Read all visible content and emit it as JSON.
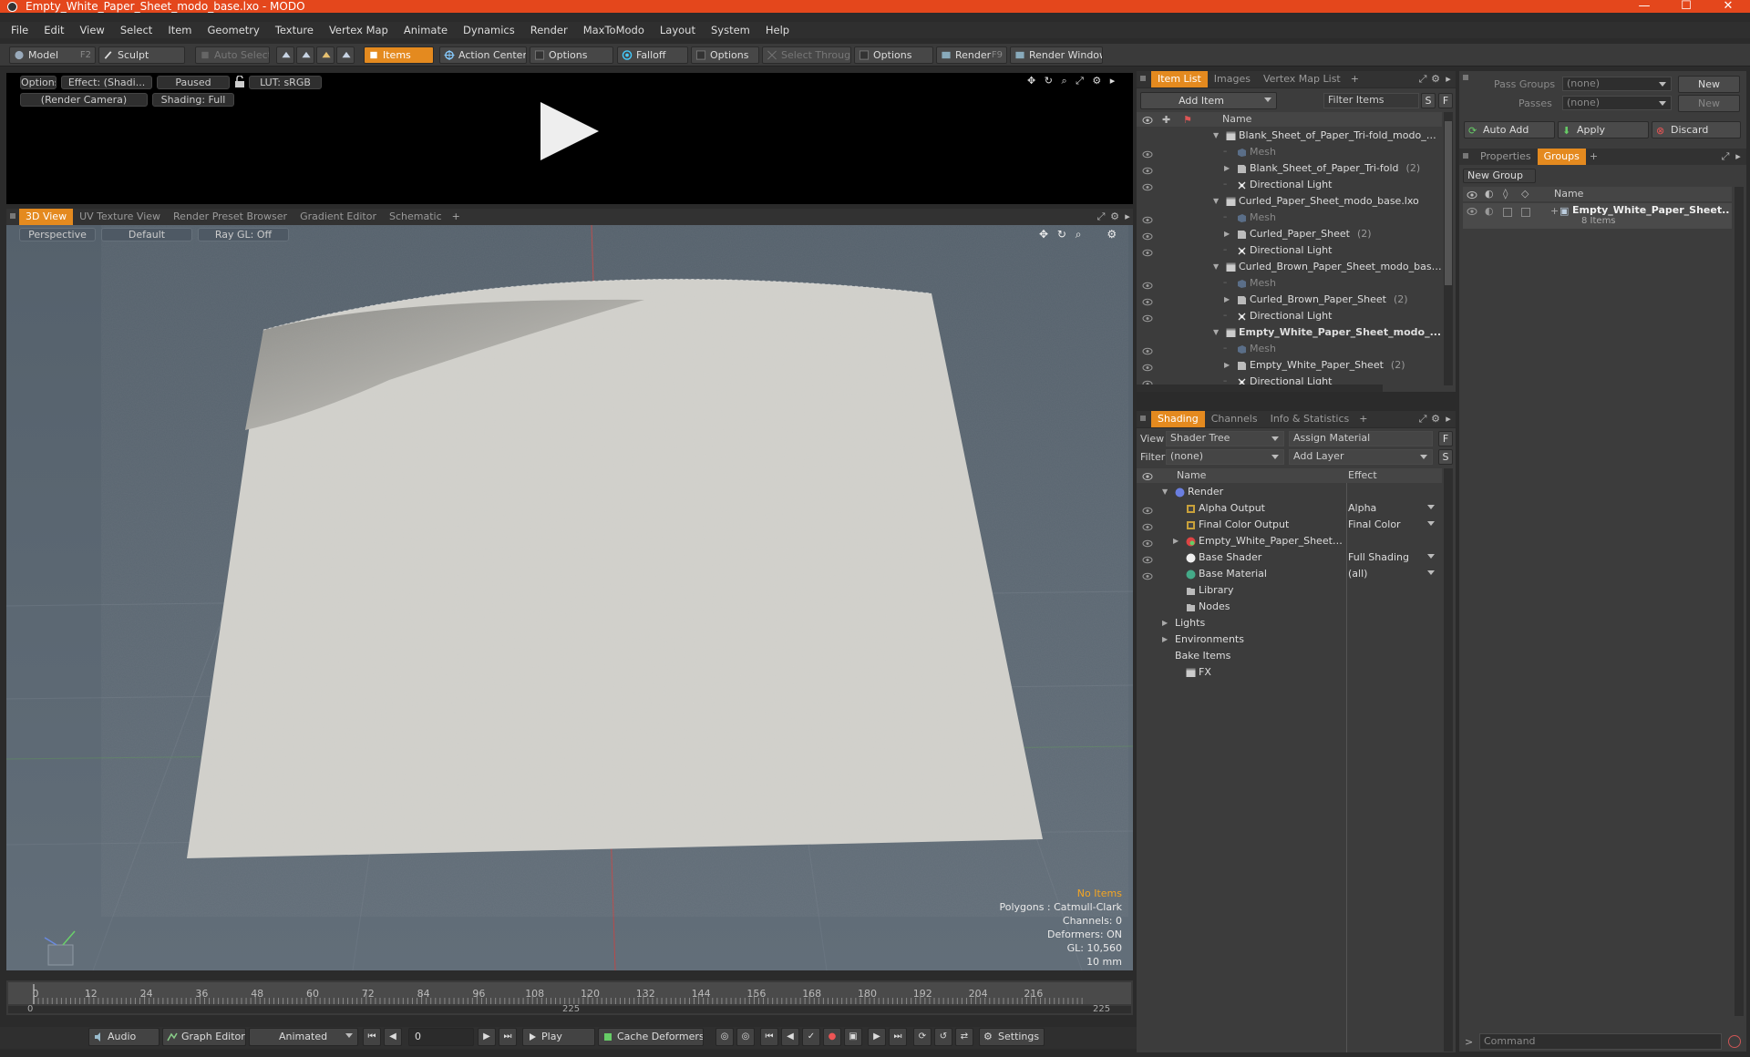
{
  "window": {
    "title": "Empty_White_Paper_Sheet_modo_base.lxo - MODO",
    "minimize": "—",
    "maximize": "☐",
    "close": "✕"
  },
  "menu": [
    "File",
    "Edit",
    "View",
    "Select",
    "Item",
    "Geometry",
    "Texture",
    "Vertex Map",
    "Animate",
    "Dynamics",
    "Render",
    "MaxToModo",
    "Layout",
    "System",
    "Help"
  ],
  "toolbar": {
    "model": "Model",
    "model_key": "F2",
    "sculpt": "Sculpt",
    "auto_select": "Auto Select",
    "items": "Items",
    "action_center": "Action Center",
    "options1": "Options",
    "falloff": "Falloff",
    "options2": "Options",
    "select_through": "Select Through",
    "options3": "Options",
    "render": "Render",
    "render_key": "F9",
    "render_window": "Render Window"
  },
  "preview": {
    "options": "Options",
    "effect": "Effect: (Shadi...",
    "paused": "Paused",
    "lut": "LUT: sRGB",
    "camera": "(Render Camera)",
    "shading": "Shading: Full"
  },
  "viewport_tabs": [
    "3D View",
    "UV Texture View",
    "Render Preset Browser",
    "Gradient Editor",
    "Schematic",
    "+"
  ],
  "viewport": {
    "perspective": "Perspective",
    "default": "Default",
    "raygl": "Ray GL: Off",
    "hud": {
      "no_items": "No Items",
      "polygons": "Polygons : Catmull-Clark",
      "channels": "Channels: 0",
      "deformers": "Deformers: ON",
      "gl": "GL: 10,560",
      "scale": "10 mm"
    },
    "colors": {
      "background": "#5a6672",
      "accent": "#f5a623",
      "paper": "#d2d1cc"
    }
  },
  "timeline": {
    "ticks": [
      "0",
      "12",
      "24",
      "36",
      "48",
      "60",
      "72",
      "84",
      "96",
      "108",
      "120",
      "132",
      "144",
      "156",
      "168",
      "180",
      "192",
      "204",
      "216"
    ],
    "start": "0",
    "mid": "225",
    "end": "225"
  },
  "bottombar": {
    "audio": "Audio",
    "graph_editor": "Graph Editor",
    "animated": "Animated",
    "frame": "0",
    "play": "Play",
    "cache_deformers": "Cache Deformers",
    "settings": "Settings"
  },
  "item_list": {
    "tabs": [
      "Item List",
      "Images",
      "Vertex Map List",
      "+"
    ],
    "add_item": "Add Item",
    "filter_items": "Filter Items",
    "s": "S",
    "f": "F",
    "name_header": "Name",
    "rows": [
      {
        "label": "Blank_Sheet_of_Paper_Tri-fold_modo_ba ...",
        "type": "scene",
        "indent": 0,
        "expand": "▼"
      },
      {
        "label": "Mesh",
        "type": "mesh",
        "indent": 1,
        "expand": ""
      },
      {
        "label": "Blank_Sheet_of_Paper_Tri-fold",
        "count": "(2)",
        "type": "group",
        "indent": 1,
        "expand": "▶"
      },
      {
        "label": "Directional Light",
        "type": "light",
        "indent": 1,
        "expand": ""
      },
      {
        "label": "Curled_Paper_Sheet_modo_base.lxo",
        "type": "scene",
        "indent": 0,
        "expand": "▼"
      },
      {
        "label": "Mesh",
        "type": "mesh",
        "indent": 1,
        "expand": ""
      },
      {
        "label": "Curled_Paper_Sheet",
        "count": "(2)",
        "type": "group",
        "indent": 1,
        "expand": "▶"
      },
      {
        "label": "Directional Light",
        "type": "light",
        "indent": 1,
        "expand": ""
      },
      {
        "label": "Curled_Brown_Paper_Sheet_modo_base.lxo",
        "type": "scene",
        "indent": 0,
        "expand": "▼"
      },
      {
        "label": "Mesh",
        "type": "mesh",
        "indent": 1,
        "expand": ""
      },
      {
        "label": "Curled_Brown_Paper_Sheet",
        "count": "(2)",
        "type": "group",
        "indent": 1,
        "expand": "▶"
      },
      {
        "label": "Directional Light",
        "type": "light",
        "indent": 1,
        "expand": ""
      },
      {
        "label": "Empty_White_Paper_Sheet_modo_...",
        "type": "scene",
        "indent": 0,
        "expand": "▼",
        "bold": true
      },
      {
        "label": "Mesh",
        "type": "mesh",
        "indent": 1,
        "expand": ""
      },
      {
        "label": "Empty_White_Paper_Sheet",
        "count": "(2)",
        "type": "group",
        "indent": 1,
        "expand": "▶"
      },
      {
        "label": "Directional Light",
        "type": "light",
        "indent": 1,
        "expand": ""
      }
    ]
  },
  "shading": {
    "tabs": [
      "Shading",
      "Channels",
      "Info & Statistics",
      "+"
    ],
    "view_label": "View",
    "view_value": "Shader Tree",
    "assign_material": "Assign Material",
    "f": "F",
    "filter_label": "Filter",
    "filter_value": "(none)",
    "add_layer": "Add Layer",
    "s": "S",
    "name_header": "Name",
    "effect_header": "Effect",
    "rows": [
      {
        "label": "Render",
        "effect": "",
        "indent": 0,
        "expand": "▼",
        "icon": "render",
        "eye": false
      },
      {
        "label": "Alpha Output",
        "effect": "Alpha",
        "indent": 1,
        "expand": "",
        "icon": "output",
        "eye": true
      },
      {
        "label": "Final Color Output",
        "effect": "Final Color",
        "indent": 1,
        "expand": "",
        "icon": "output",
        "eye": true
      },
      {
        "label": "Empty_White_Paper_Sheet ...",
        "effect": "",
        "indent": 1,
        "expand": "▶",
        "icon": "material-group",
        "eye": true
      },
      {
        "label": "Base Shader",
        "effect": "Full Shading",
        "indent": 1,
        "expand": "",
        "icon": "shader",
        "eye": true
      },
      {
        "label": "Base Material",
        "effect": "(all)",
        "indent": 1,
        "expand": "",
        "icon": "material",
        "eye": true
      },
      {
        "label": "Library",
        "effect": "",
        "indent": 1,
        "expand": "",
        "icon": "folder",
        "eye": false
      },
      {
        "label": "Nodes",
        "effect": "",
        "indent": 1,
        "expand": "",
        "icon": "folder",
        "eye": false
      },
      {
        "label": "Lights",
        "effect": "",
        "indent": 0,
        "expand": "▶",
        "icon": "",
        "eye": false
      },
      {
        "label": "Environments",
        "effect": "",
        "indent": 0,
        "expand": "▶",
        "icon": "",
        "eye": false
      },
      {
        "label": "Bake Items",
        "effect": "",
        "indent": 0,
        "expand": "",
        "icon": "",
        "eye": false
      },
      {
        "label": "FX",
        "effect": "",
        "indent": 1,
        "expand": "",
        "icon": "fx",
        "eye": false
      }
    ]
  },
  "groups_panel": {
    "pass_groups_label": "Pass Groups",
    "pass_groups_value": "(none)",
    "passes_label": "Passes",
    "passes_value": "(none)",
    "new1": "New",
    "new2": "New",
    "auto_add": "Auto Add",
    "apply": "Apply",
    "discard": "Discard",
    "tabs": [
      "Properties",
      "Groups",
      "+"
    ],
    "new_group": "New Group",
    "name_header": "Name",
    "group_name": "Empty_White_Paper_Sheet...",
    "group_count": "8 Items",
    "command_placeholder": "Command",
    "command_prompt": ">"
  }
}
